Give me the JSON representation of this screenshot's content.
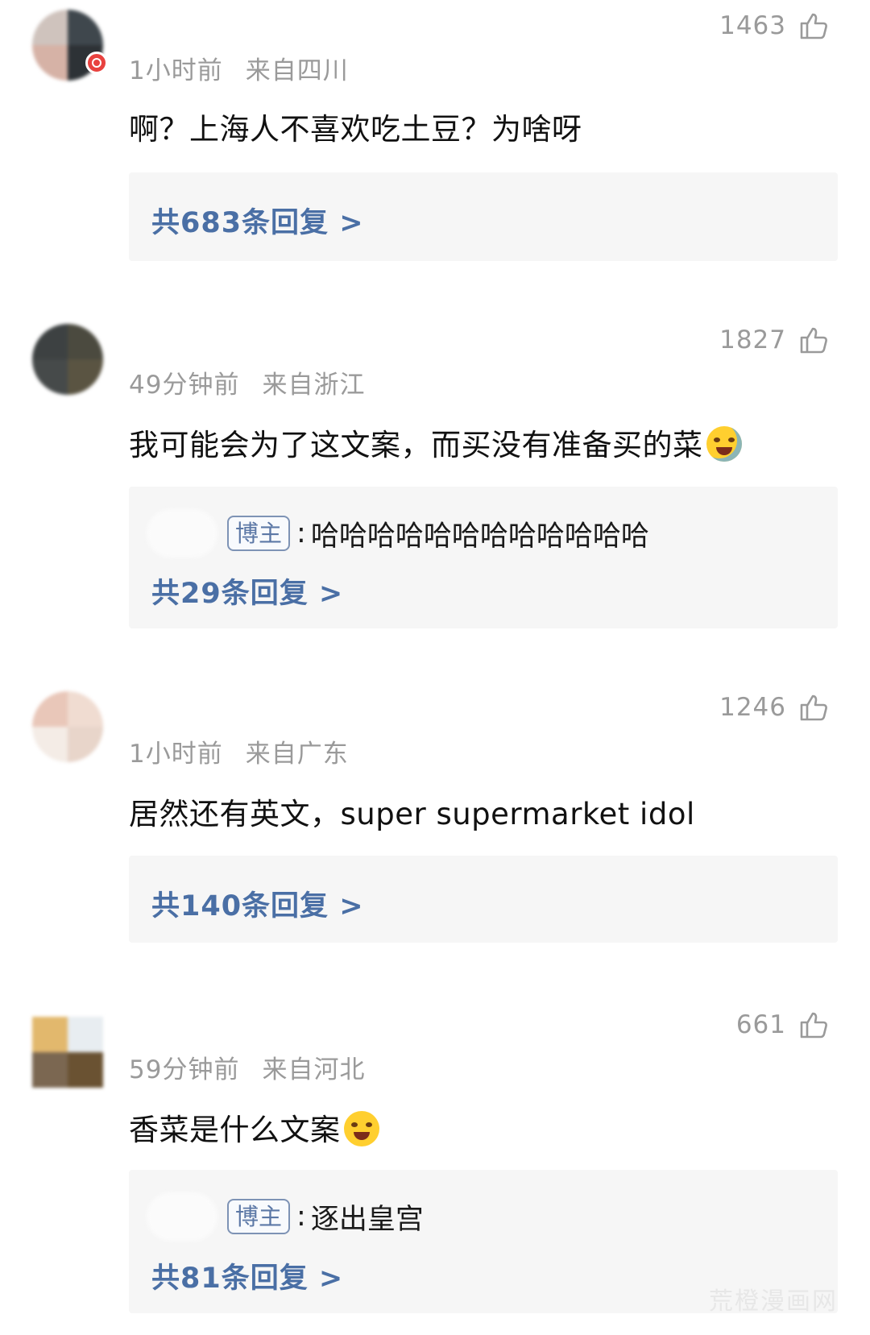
{
  "comments": [
    {
      "time": "1小时前",
      "location": "来自四川",
      "likes": "1463",
      "text": "啊？上海人不喜欢吃土豆？为啥呀",
      "reply_count": "共683条回复 >"
    },
    {
      "time": "49分钟前",
      "location": "来自浙江",
      "likes": "1827",
      "text": "我可能会为了这文案，而买没有准备买的菜",
      "emoji": "crying-laughing-emoji",
      "author_reply": {
        "tag": "博主",
        "separator": ":",
        "text": "哈哈哈哈哈哈哈哈哈哈哈哈"
      },
      "reply_count": "共29条回复 >"
    },
    {
      "time": "1小时前",
      "location": "来自广东",
      "likes": "1246",
      "text": "居然还有英文，super supermarket idol",
      "reply_count": "共140条回复 >"
    },
    {
      "time": "59分钟前",
      "location": "来自河北",
      "likes": "661",
      "text": "香菜是什么文案",
      "emoji": "crying-emoji",
      "author_reply": {
        "tag": "博主",
        "separator": ":",
        "text": "逐出皇宫"
      },
      "reply_count": "共81条回复 >"
    }
  ],
  "icons": {
    "like": "thumbs-up-icon"
  },
  "colors": {
    "link_blue": "#4a6fa5",
    "meta_gray": "#9a9a9a",
    "reply_bg": "#f6f6f6"
  },
  "watermark": "荒橙漫画网"
}
